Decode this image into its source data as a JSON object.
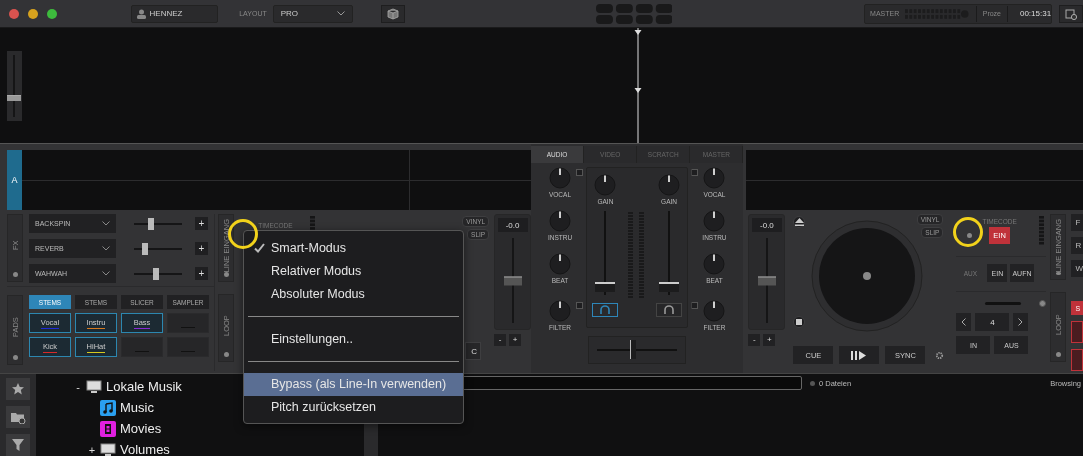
{
  "titlebar": {
    "user": "HENNEZ",
    "layout_label": "LAYOUT",
    "layout_value": "PRO",
    "master_label": "MASTER",
    "master_mode": "Proze",
    "clock": "00:15:31"
  },
  "waveform": {
    "zoom": {
      "level": 0.3
    }
  },
  "deck_left": {
    "label": "A",
    "fx_label": "FX",
    "fx": [
      {
        "name": "BACKSPIN",
        "level": 0.35,
        "add": "+"
      },
      {
        "name": "REVERB",
        "level": 0.22,
        "add": "+"
      },
      {
        "name": "WAHWAH",
        "level": 0.45,
        "add": "+"
      }
    ],
    "pads_label": "PADS",
    "pad_tabs": [
      {
        "label": "STEMS",
        "selected": true
      },
      {
        "label": "STEMS",
        "selected": false
      },
      {
        "label": "SLICER",
        "selected": false
      },
      {
        "label": "SAMPLER",
        "selected": false
      }
    ],
    "pads": [
      {
        "kind": "stem",
        "label": "Vocal",
        "color": "#1f2ad6"
      },
      {
        "kind": "stem",
        "label": "Instru",
        "color": "#d67a1f"
      },
      {
        "kind": "stem",
        "label": "Bass",
        "color": "#8a2ad6"
      },
      {
        "kind": "empty"
      },
      {
        "kind": "stem",
        "label": "Kick",
        "color": "#d62a2a"
      },
      {
        "kind": "stem",
        "label": "HiHat",
        "color": "#d6c81f"
      },
      {
        "kind": "empty"
      },
      {
        "kind": "empty"
      }
    ],
    "line_in_label": "LINE EINGANG",
    "timecode_label": "TIMECODE",
    "loop_label": "LOOP",
    "vinyl": "VINYL",
    "slip": "SLIP",
    "edge_text": "C",
    "pitch": {
      "value": "-0.0",
      "level": 0.5,
      "minus": "-",
      "plus": "+"
    }
  },
  "mixer": {
    "tabs": [
      {
        "label": "AUDIO",
        "selected": true
      },
      {
        "label": "VIDEO",
        "selected": false
      },
      {
        "label": "SCRATCH",
        "selected": false
      },
      {
        "label": "MASTER",
        "selected": false
      }
    ],
    "eq_left": [
      "VOCAL",
      "INSTRU",
      "BEAT",
      "FILTER"
    ],
    "eq_right": [
      "VOCAL",
      "INSTRU",
      "BEAT",
      "FILTER"
    ],
    "channels": [
      {
        "gain_label": "GAIN",
        "level": 0.03,
        "headphones": true
      },
      {
        "gain_label": "GAIN",
        "level": 0.03,
        "headphones": false
      }
    ],
    "crossfader": {
      "level": 0.42
    }
  },
  "deck_right": {
    "pitch": {
      "value": "-0.0",
      "level": 0.5,
      "minus": "-",
      "plus": "+"
    },
    "vinyl": "VINYL",
    "slip": "SLIP",
    "transport": {
      "cue": "CUE",
      "sync": "SYNC"
    },
    "timecode_label": "TIMECODE",
    "timecode_button": {
      "label": "EIN",
      "on": true
    },
    "aux_label": "AUX",
    "aux_buttons": [
      "EIN",
      "AUFN"
    ],
    "loop_size": "4",
    "loop_in": "IN",
    "loop_out": "AUS",
    "line_in_label": "LINE EINGANG",
    "loop_label": "LOOP",
    "edge_fx": [
      "F",
      "R",
      "W"
    ],
    "edge_pad": "S"
  },
  "context_menu": [
    {
      "kind": "check",
      "label": "Smart-Modus",
      "selected": true,
      "highlighted": false
    },
    {
      "kind": "check",
      "label": "Relativer Modus",
      "selected": false,
      "highlighted": false
    },
    {
      "kind": "check",
      "label": "Absoluter Modus",
      "selected": false,
      "highlighted": false
    },
    {
      "kind": "separator"
    },
    {
      "kind": "item",
      "label": "Einstellungen..",
      "highlighted": false
    },
    {
      "kind": "separator"
    },
    {
      "kind": "item",
      "label": "Bypass (als Line-In verwenden)",
      "highlighted": true
    },
    {
      "kind": "item",
      "label": "Pitch zurücksetzen",
      "highlighted": false
    }
  ],
  "browser": {
    "tree": [
      {
        "label": "Lokale Musik",
        "toggle": "-",
        "children": [
          {
            "label": "Music",
            "kind": "music"
          },
          {
            "label": "Movies",
            "kind": "video"
          },
          {
            "label": "Volumes",
            "kind": "drive",
            "toggle": "+"
          }
        ]
      }
    ],
    "file_count": "0 Dateien",
    "view_label": "Browsing"
  }
}
